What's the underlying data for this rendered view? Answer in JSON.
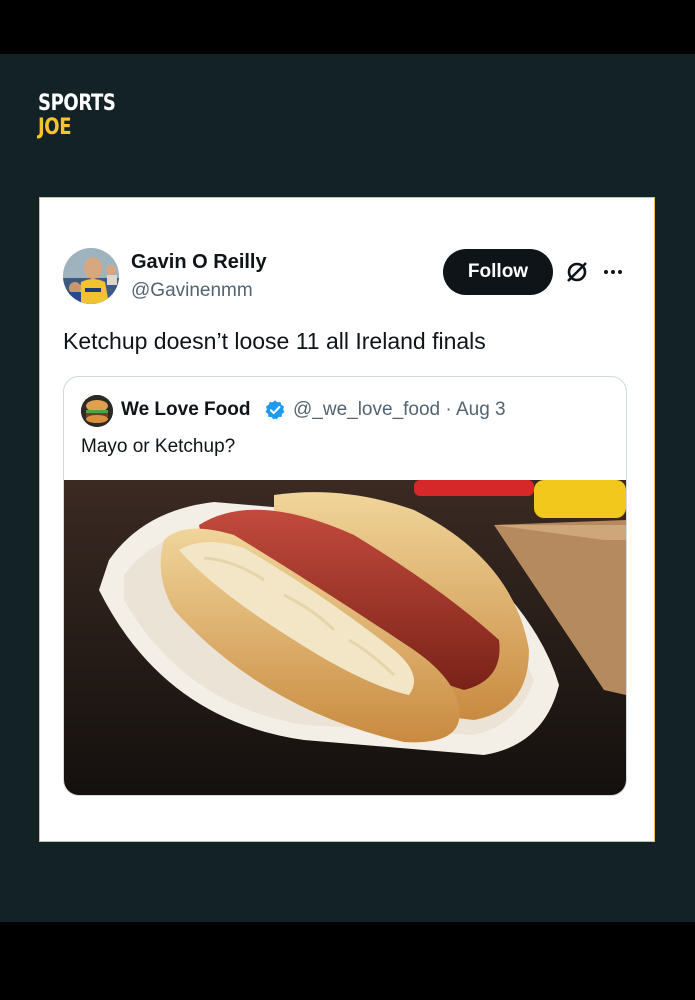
{
  "brand": {
    "line1": "SPORTS",
    "line2": "JOE"
  },
  "tweet": {
    "author_name": "Gavin O Reilly",
    "author_handle": "@Gavinenmm",
    "follow_label": "Follow",
    "text": "Ketchup doesn’t loose 11 all Ireland finals"
  },
  "quoted": {
    "author_name": "We Love Food",
    "author_handle": "@_we_love_food",
    "separator": "·",
    "date": "Aug 3",
    "text": "Mayo or Ketchup?"
  },
  "icons": [
    "x-logo-icon",
    "more-icon",
    "verified-icon"
  ],
  "colors": {
    "background": "#132226",
    "brand_yellow": "#f5c431",
    "card_border": "#e8c23a",
    "verified": "#1d9bf0"
  }
}
